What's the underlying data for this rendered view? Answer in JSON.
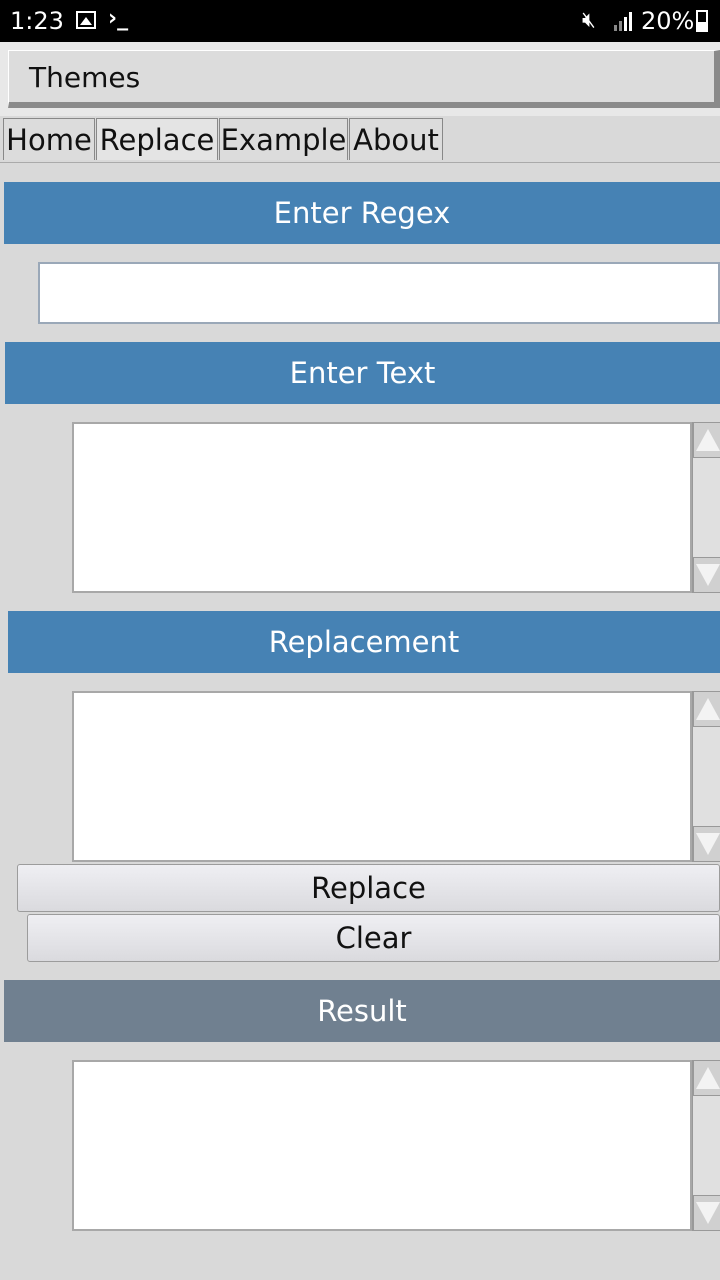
{
  "status_bar": {
    "time": "1:23",
    "battery": "20%",
    "icons": [
      "image-icon",
      "terminal-icon",
      "mute-icon",
      "signal-icon",
      "battery-icon"
    ]
  },
  "title_bar": {
    "title": "Themes"
  },
  "tabs": [
    {
      "label": "Home"
    },
    {
      "label": "Replace"
    },
    {
      "label": "Example"
    },
    {
      "label": "About"
    }
  ],
  "active_tab": "Replace",
  "sections": {
    "regex": {
      "header": "Enter Regex",
      "value": ""
    },
    "text": {
      "header": "Enter Text",
      "value": ""
    },
    "replacement": {
      "header": "Replacement",
      "value": ""
    },
    "result": {
      "header": "Result",
      "value": ""
    }
  },
  "buttons": {
    "replace": "Replace",
    "clear": "Clear"
  },
  "colors": {
    "header_blue": "#4682b4",
    "header_result": "#708090",
    "background": "#d9d9d9"
  }
}
